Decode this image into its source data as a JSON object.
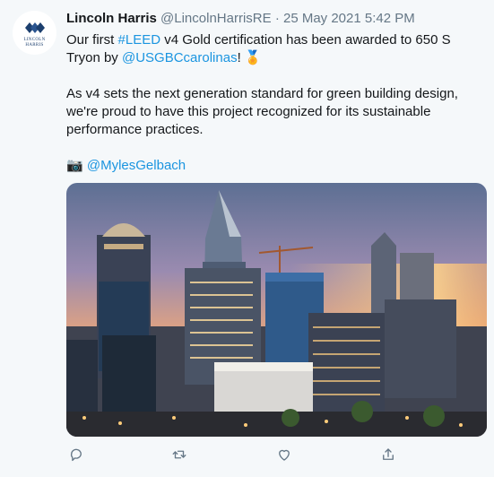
{
  "account": {
    "name": "Lincoln Harris",
    "handle": "@LincolnHarrisRE",
    "separator": "·",
    "timestamp": "25 May 2021 5:42 PM",
    "avatar_text": [
      "LINCOLN",
      "HARRIS"
    ]
  },
  "tweet": {
    "line1_a": "Our first ",
    "hashtag": "#LEED",
    "line1_b": " v4 Gold certification has been awarded to 650 S Tryon by ",
    "mention": "@USGBCcarolinas",
    "line1_c": "! ",
    "medal_emoji": "🏅",
    "paragraph2": "As v4 sets the next generation standard for green building design, we're proud to have this project recognized for its sustainable performance practices.",
    "camera_emoji": "📷",
    "photo_credit": "@MylesGelbach"
  },
  "actions": [
    {
      "icon": "reply-icon"
    },
    {
      "icon": "retweet-icon"
    },
    {
      "icon": "like-icon"
    },
    {
      "icon": "share-icon"
    }
  ],
  "colors": {
    "background": "#f5f8fa",
    "text": "#14171a",
    "secondary": "#657786",
    "link": "#1b95e0"
  }
}
